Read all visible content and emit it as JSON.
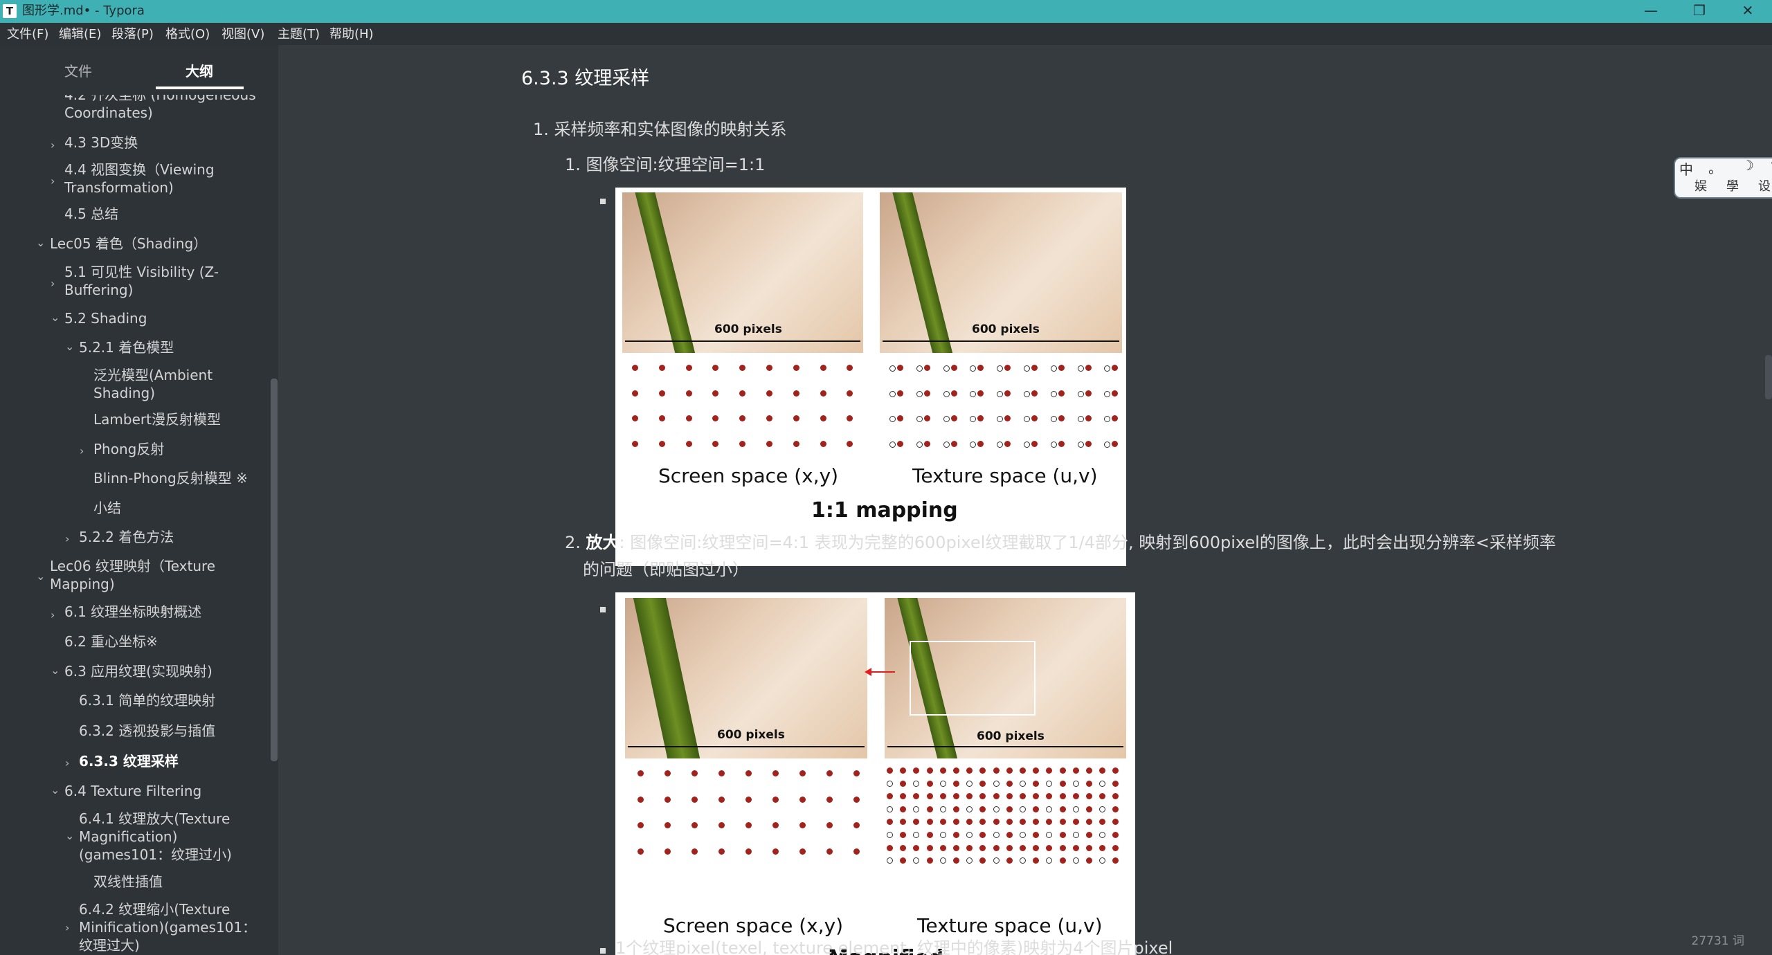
{
  "window": {
    "title": "图形学.md• - Typora",
    "app_icon": "T",
    "minimize": "—",
    "maximize": "❐",
    "close": "✕"
  },
  "menu": [
    "文件(F)",
    "编辑(E)",
    "段落(P)",
    "格式(O)",
    "视图(V)",
    "主题(T)",
    "帮助(H)"
  ],
  "sidebar": {
    "tabs": {
      "files": "文件",
      "outline": "大纲"
    },
    "outline": [
      {
        "label": "4.2 齐次坐标 (Homogeneous",
        "chev": ""
      },
      {
        "label": "Coordinates)",
        "chev": ""
      },
      {
        "label": "4.3 3D变换",
        "chev": "›"
      },
      {
        "label": "4.4 视图变换（Viewing",
        "chev": "›"
      },
      {
        "label": "Transformation)",
        "chev": ""
      },
      {
        "label": "4.5 总结",
        "chev": ""
      },
      {
        "label": "Lec05 着色（Shading）",
        "chev": "⌄"
      },
      {
        "label": "5.1 可见性 Visibility (Z-",
        "chev": "›"
      },
      {
        "label": "Buffering)",
        "chev": ""
      },
      {
        "label": "5.2 Shading",
        "chev": "⌄"
      },
      {
        "label": "5.2.1 着色模型",
        "chev": "⌄"
      },
      {
        "label": "泛光模型(Ambient",
        "chev": ""
      },
      {
        "label": "Shading)",
        "chev": ""
      },
      {
        "label": "Lambert漫反射模型",
        "chev": ""
      },
      {
        "label": "Phong反射",
        "chev": "›"
      },
      {
        "label": "Blinn-Phong反射模型 ※",
        "chev": ""
      },
      {
        "label": "小结",
        "chev": ""
      },
      {
        "label": "5.2.2 着色方法",
        "chev": "›"
      },
      {
        "label": "Lec06 纹理映射（Texture",
        "chev": "⌄"
      },
      {
        "label": "Mapping)",
        "chev": ""
      },
      {
        "label": "6.1 纹理坐标映射概述",
        "chev": "›"
      },
      {
        "label": "6.2 重心坐标※",
        "chev": ""
      },
      {
        "label": "6.3 应用纹理(实现映射)",
        "chev": "⌄"
      },
      {
        "label": "6.3.1 简单的纹理映射",
        "chev": ""
      },
      {
        "label": "6.3.2 透视投影与插值",
        "chev": ""
      },
      {
        "label": "6.3.3 纹理采样",
        "chev": "›"
      },
      {
        "label": "6.4 Texture Filtering",
        "chev": "⌄"
      },
      {
        "label": "6.4.1 纹理放大(Texture",
        "chev": "⌄"
      },
      {
        "label": "Magnification)",
        "chev": ""
      },
      {
        "label": "(games101：纹理过小)",
        "chev": ""
      },
      {
        "label": "双线性插值",
        "chev": ""
      },
      {
        "label": "6.4.2 纹理缩小(Texture",
        "chev": "›"
      },
      {
        "label": "Minification)(games101：",
        "chev": ""
      },
      {
        "label": "纹理过大)",
        "chev": ""
      }
    ],
    "footer": {
      "back": "‹",
      "source": "</>"
    }
  },
  "content": {
    "heading": "6.3.3 纹理采样",
    "item1": "1. 采样频率和实体图像的映射关系",
    "item1_1": "1. 图像空间:纹理空间=1:1",
    "fig1": {
      "pixels": "600 pixels",
      "left_caption": "Screen space (x,y)",
      "right_caption": "Texture space (u,v)",
      "title": "1:1 mapping"
    },
    "item2_num": "2.",
    "item2_bold": "放大",
    "item2_text": ": 图像空间:纹理空间=4:1 表现为完整的600pixel纹理截取了1/4部分, 映射到600pixel的图像上，此时会出现分辨率<采样频率",
    "item2_text2": "的问题（即贴图过小）",
    "fig2": {
      "pixels": "600 pixels",
      "left_caption": "Screen space (x,y)",
      "right_caption": "Texture space (u,v)",
      "title": "Magnified"
    },
    "item3": "1个纹理pixel(texel, texture element, 纹理中的像素)映射为4个图片pixel"
  },
  "sticker": {
    "chars": [
      "中",
      "。",
      "☽",
      "❦",
      "娱",
      "學",
      "设"
    ]
  },
  "status": {
    "word_count": "27731 词"
  }
}
